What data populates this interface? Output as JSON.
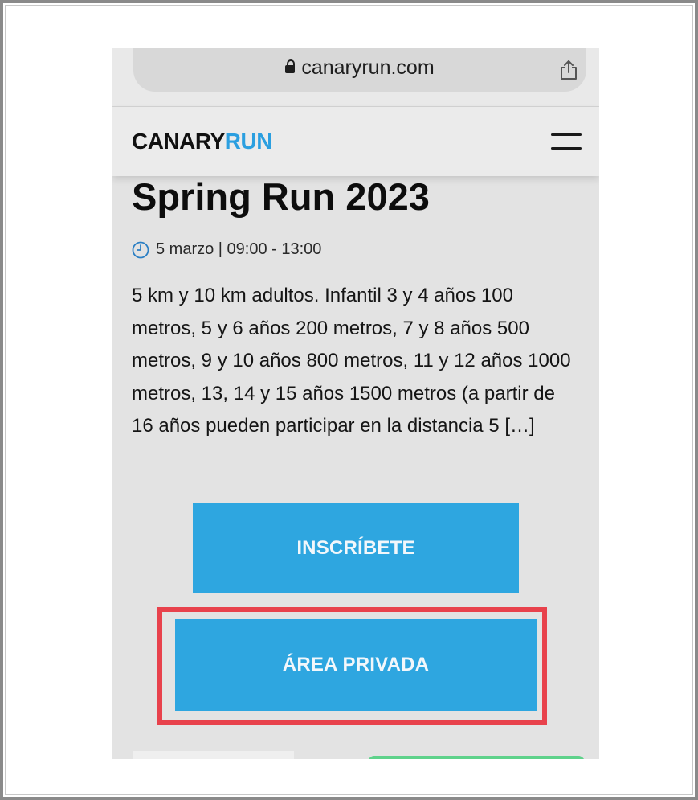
{
  "browser": {
    "url": "canaryrun.com",
    "lock_icon": "lock-icon",
    "share_icon": "share-icon"
  },
  "header": {
    "logo_part1": "CANARY",
    "logo_part2": "RUN",
    "menu_icon": "hamburger-menu-icon",
    "brand_color": "#2b9fe0"
  },
  "event": {
    "title": "Spring Run 2023",
    "datetime": "5 marzo | 09:00 - 13:00",
    "clock_icon": "clock-icon",
    "description": "5 km y 10 km adultos. Infantil 3 y 4 años 100 metros, 5 y 6 años 200 metros, 7 y 8 años 500 metros, 9 y 10 años 800 metros, 11 y 12 años 1000 metros, 13, 14 y 15 años 1500 metros (a partir de 16 años pueden participar en la distancia 5 […]"
  },
  "buttons": {
    "register_label": "INSCRÍBETE",
    "private_area_label": "ÁREA PRIVADA",
    "button_color": "#2ea6e0",
    "highlight_color": "#e8424c"
  }
}
